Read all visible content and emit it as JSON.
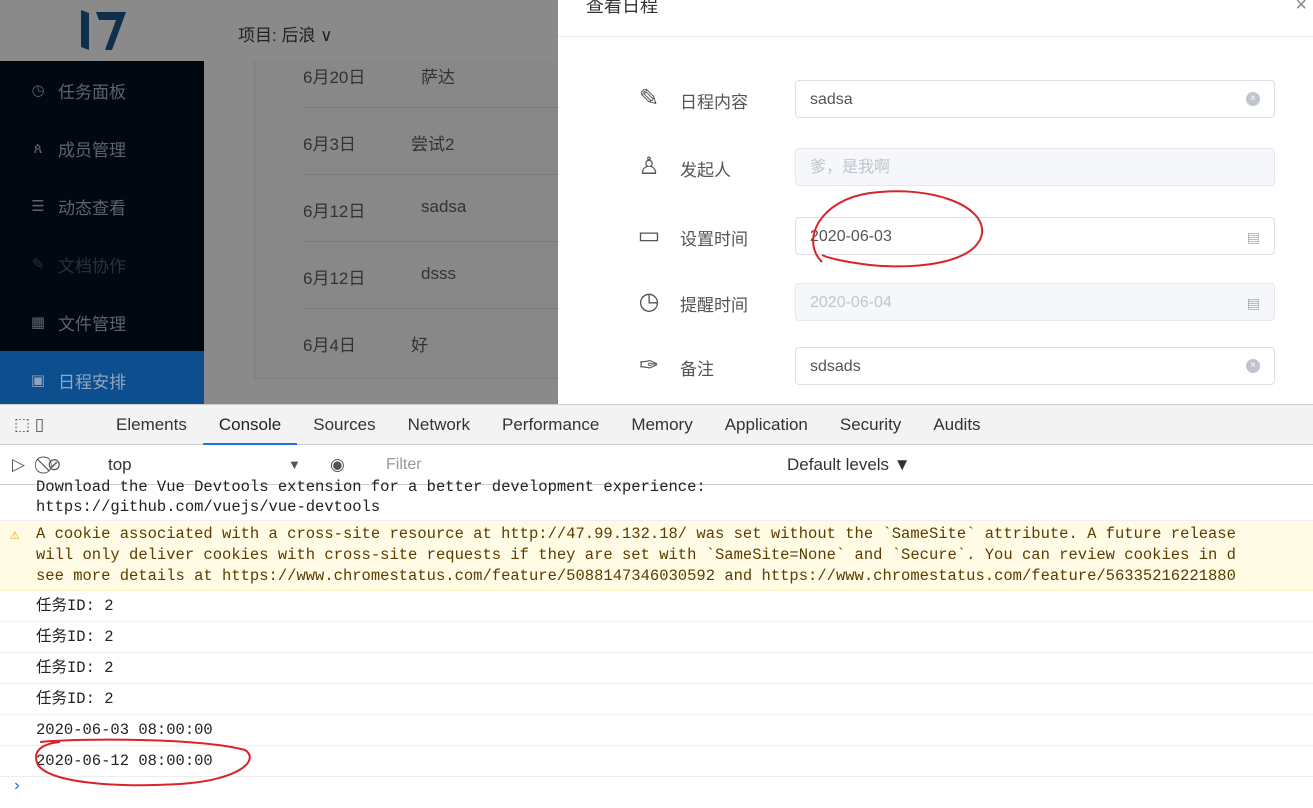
{
  "header": {
    "project_label": "项目: 后浪 ∨",
    "logo_text": "17"
  },
  "sidebar": {
    "items": [
      {
        "icon": "clock-icon",
        "glyph": "◷",
        "label": "任务面板"
      },
      {
        "icon": "users-icon",
        "glyph": "ጰ",
        "label": "成员管理"
      },
      {
        "icon": "list-icon",
        "glyph": "☰",
        "label": "动态查看"
      },
      {
        "icon": "edit-icon",
        "glyph": "✎",
        "label": "文档协作"
      },
      {
        "icon": "grid-icon",
        "glyph": "▦",
        "label": "文件管理"
      },
      {
        "icon": "calendar-icon",
        "glyph": "▣",
        "label": "日程安排"
      }
    ]
  },
  "schedule_list": [
    {
      "date": "6月20日",
      "title": "萨达"
    },
    {
      "date": "6月3日",
      "title": "尝试2"
    },
    {
      "date": "6月12日",
      "title": "sadsa"
    },
    {
      "date": "6月12日",
      "title": "dsss"
    },
    {
      "date": "6月4日",
      "title": "好"
    }
  ],
  "dialog": {
    "title": "查看日程",
    "close": "×",
    "fields": [
      {
        "label": "日程内容",
        "value": "sadsa",
        "placeholder": ""
      },
      {
        "label": "发起人",
        "value": "",
        "placeholder": "爹，是我啊"
      },
      {
        "label": "设置时间",
        "value": "2020-06-03"
      },
      {
        "label": "提醒时间",
        "value": "2020-06-04"
      },
      {
        "label": "备注",
        "value": "sdsads"
      }
    ]
  },
  "devtools": {
    "tabs": [
      "Elements",
      "Console",
      "Sources",
      "Network",
      "Performance",
      "Memory",
      "Application",
      "Security",
      "Audits"
    ],
    "context": "top",
    "filter_placeholder": "Filter",
    "levels": "Default levels ▼",
    "messages": {
      "vue_line1": "Download the Vue Devtools extension for a better development experience:",
      "vue_link": "https://github.com/vuejs/vue-devtools",
      "warn_1": "A cookie associated with a cross-site resource at ",
      "warn_link1": "http://47.99.132.18/",
      "warn_2": " was set without the `SameSite` attribute. A future release",
      "warn_3": "will only deliver cookies with cross-site requests if they are set with `SameSite=None` and `Secure`. You can review cookies in d",
      "warn_4": "see more details at ",
      "warn_link2": "https://www.chromestatus.com/feature/5088147346030592",
      "warn_5": " and ",
      "warn_link3": "https://www.chromestatus.com/feature/56335216221880",
      "logs": [
        "任务ID: 2",
        "任务ID: 2",
        "任务ID: 2",
        "任务ID: 2",
        "2020-06-03 08:00:00",
        "2020-06-12 08:00:00"
      ]
    },
    "prompt": "›"
  }
}
